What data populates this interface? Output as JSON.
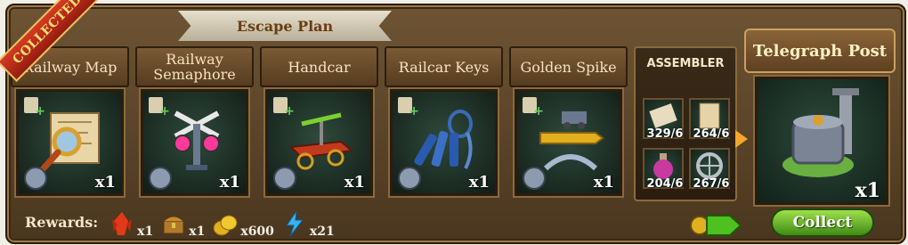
{
  "banner": {
    "title": "Escape Plan"
  },
  "ribbon": {
    "text": "COLLECTED"
  },
  "items": [
    {
      "name": "Railway Map",
      "qty": "x1",
      "icon": "map-with-magnifier-icon"
    },
    {
      "name": "Railway\nSemaphore",
      "qty": "x1",
      "icon": "semaphore-icon"
    },
    {
      "name": "Handcar",
      "qty": "x1",
      "icon": "handcar-icon"
    },
    {
      "name": "Railcar Keys",
      "qty": "x1",
      "icon": "keys-icon"
    },
    {
      "name": "Golden Spike",
      "qty": "x1",
      "icon": "golden-spike-icon"
    }
  ],
  "assembler": {
    "label": "ASSEMBLER",
    "materials": [
      {
        "count": "329/6",
        "icon": "papers-icon"
      },
      {
        "count": "264/6",
        "icon": "parchment-icon"
      },
      {
        "count": "204/6",
        "icon": "potion-icon"
      },
      {
        "count": "267/6",
        "icon": "wheel-icon"
      }
    ]
  },
  "result": {
    "name": "Telegraph Post",
    "qty": "x1",
    "icon": "telegraph-post-icon"
  },
  "buttons": {
    "collect": "Collect"
  },
  "rewards": {
    "label": "Rewards:",
    "list": [
      {
        "icon": "red-crystal-icon",
        "amount": "x1"
      },
      {
        "icon": "treasure-chest-icon",
        "amount": "x1"
      },
      {
        "icon": "gold-coins-icon",
        "amount": "x600"
      },
      {
        "icon": "lightning-energy-icon",
        "amount": "x21"
      }
    ]
  },
  "colors": {
    "frame": "#5a4128",
    "accent_green": "#6cc02a",
    "ribbon_red": "#c62a18",
    "title_gold": "#f7e2c0"
  }
}
